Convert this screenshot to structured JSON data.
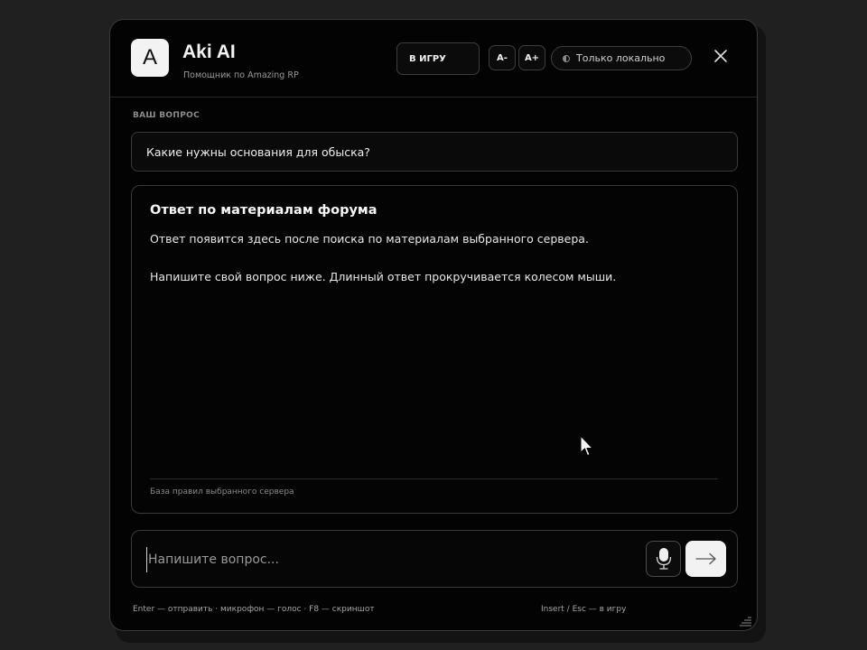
{
  "header": {
    "logo_letter": "A",
    "title": "Aki AI",
    "subtitle": "Помощник по Amazing RP",
    "game_button": "В ИГРУ",
    "font_minus": "A-",
    "font_plus": "A+",
    "local_toggle": "Только локально",
    "close_icon": "close-icon"
  },
  "question": {
    "label": "ВАШ ВОПРОС",
    "text": "Какие нужны основания для обыска?"
  },
  "answer": {
    "title": "Ответ по материалам форума",
    "paragraph1": "Ответ появится здесь после поиска по материалам выбранного сервера.",
    "paragraph2": "Напишите свой вопрос ниже. Длинный ответ прокручивается колесом мыши.",
    "footer": "База правил выбранного сервера"
  },
  "composer": {
    "placeholder": "Напишите вопрос...",
    "value": "",
    "mic_icon": "microphone-icon",
    "send_icon": "arrow-right-icon"
  },
  "hints": {
    "left": "Enter — отправить  ·  микрофон — голос  ·  F8 — скриншот",
    "right": "Insert / Esc — в игру"
  },
  "colors": {
    "window_bg": "#030303",
    "page_bg": "#202020",
    "border": "#3a3a3a",
    "accent_light": "#f2f2f2"
  }
}
